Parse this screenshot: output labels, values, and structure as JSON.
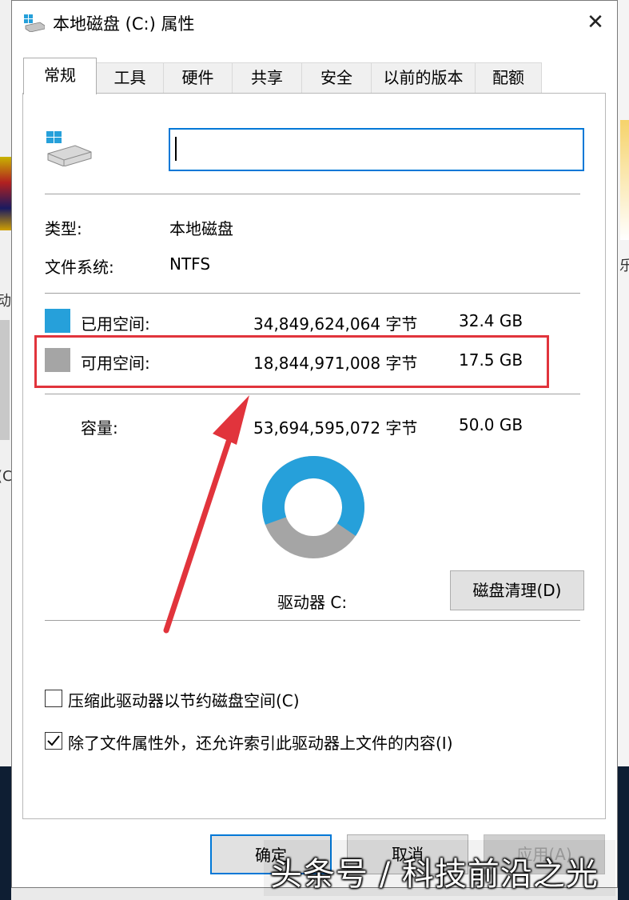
{
  "window": {
    "title": "本地磁盘 (C:) 属性",
    "close_symbol": "✕"
  },
  "tabs": [
    "常规",
    "工具",
    "硬件",
    "共享",
    "安全",
    "以前的版本",
    "配额"
  ],
  "active_tab": "常规",
  "general": {
    "name_value": "",
    "type_label": "类型:",
    "type_value": "本地磁盘",
    "fs_label": "文件系统:",
    "fs_value": "NTFS",
    "used": {
      "label": "已用空间:",
      "bytes": "34,849,624,064 字节",
      "size": "32.4 GB",
      "color": "#26a0da"
    },
    "free": {
      "label": "可用空间:",
      "bytes": "18,844,971,008 字节",
      "size": "17.5 GB",
      "color": "#a5a5a5"
    },
    "capacity": {
      "label": "容量:",
      "bytes": "53,694,595,072 字节",
      "size": "50.0 GB"
    },
    "drive_label": "驱动器 C:",
    "cleanup_button": "磁盘清理(D)",
    "used_fraction": 0.649
  },
  "options": {
    "compress": {
      "label": "压缩此驱动器以节约磁盘空间(C)",
      "checked": false
    },
    "index": {
      "label": "除了文件属性外，还允许索引此驱动器上文件的内容(I)",
      "checked": true
    }
  },
  "buttons": {
    "ok": "确定",
    "cancel": "取消",
    "apply": "应用(A)"
  },
  "background": {
    "left_char_1": "动",
    "left_char_2": "(C",
    "right_char": "乐"
  },
  "watermark": "头条号 / 科技前沿之光",
  "colors": {
    "accent": "#0078d7",
    "highlight_box": "#e1343c",
    "arrow": "#e1343c"
  }
}
